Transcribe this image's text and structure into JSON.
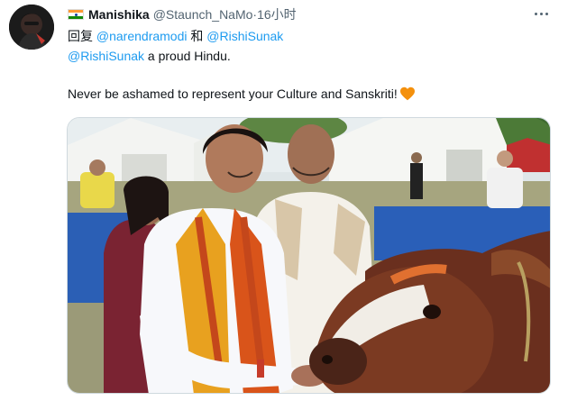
{
  "author": {
    "display_name": "Manishika",
    "handle": "@Staunch_NaMo",
    "separator": " · ",
    "time": "16小时",
    "flag_icon": "india-flag-icon"
  },
  "reply": {
    "prefix": "回复",
    "mention_1": "@narendramodi",
    "conjunction": "和",
    "mention_2": "@RishiSunak"
  },
  "body": {
    "line1_mention": "@RishiSunak",
    "line1_text": " a proud Hindu.",
    "line2_text": "Never be ashamed to represent your Culture and Sanskriti!",
    "heart_icon": "orange-heart-icon"
  },
  "media": {
    "type": "photo",
    "icon": "tweet-photo"
  },
  "menu_icon": "more-options-icon",
  "colors": {
    "link": "#1d9bf0",
    "secondary_text": "#536471",
    "heart": "#f4900c"
  }
}
